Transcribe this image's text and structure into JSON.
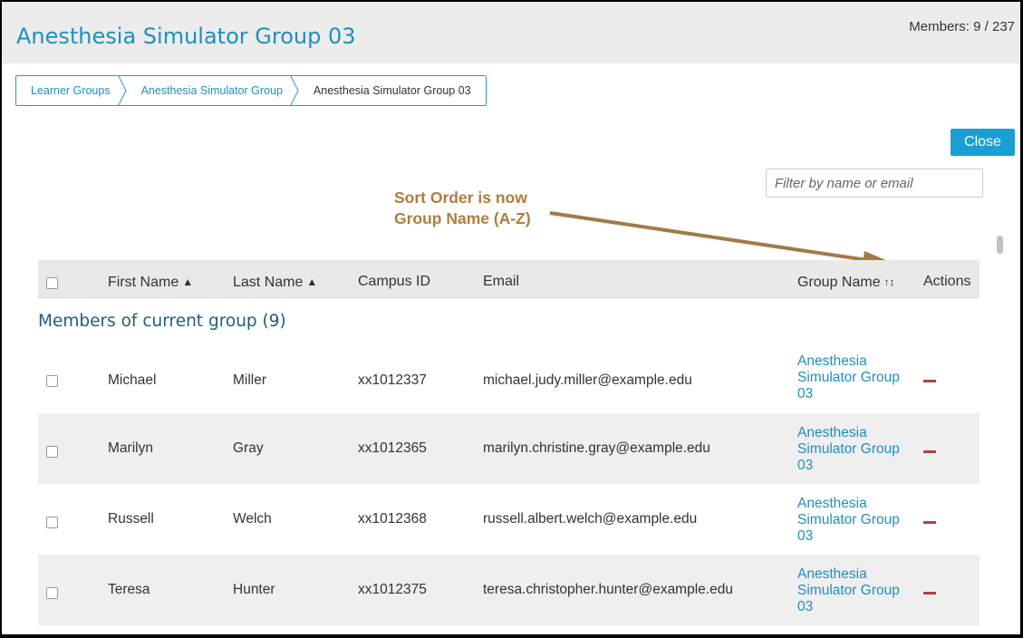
{
  "header": {
    "title": "Anesthesia Simulator Group 03",
    "members_count": "Members: 9 / 237"
  },
  "breadcrumb": [
    {
      "label": "Learner Groups"
    },
    {
      "label": "Anesthesia Simulator Group"
    },
    {
      "label": "Anesthesia Simulator Group 03"
    }
  ],
  "close_label": "Close",
  "filter": {
    "placeholder": "Filter by name or email",
    "value": ""
  },
  "annotation": {
    "line1": "Sort Order is now",
    "line2": "Group Name (A-Z)",
    "color": "#b07d3c"
  },
  "table": {
    "columns": {
      "first_name": "First Name",
      "last_name": "Last Name",
      "campus_id": "Campus ID",
      "email": "Email",
      "group_name": "Group Name",
      "actions": "Actions"
    },
    "sort_icon": "sort-up-down-icon",
    "active_sort_icon": "sort-alpha-asc-icon"
  },
  "group_heading": "Members of current group (9)",
  "rows": [
    {
      "first": "Michael",
      "last": "Miller",
      "campus_id": "xx1012337",
      "email": "michael.judy.miller@example.edu",
      "group": [
        "Anesthesia",
        "Simulator Group",
        "03"
      ]
    },
    {
      "first": "Marilyn",
      "last": "Gray",
      "campus_id": "xx1012365",
      "email": "marilyn.christine.gray@example.edu",
      "group": [
        "Anesthesia",
        "Simulator Group",
        "03"
      ]
    },
    {
      "first": "Russell",
      "last": "Welch",
      "campus_id": "xx1012368",
      "email": "russell.albert.welch@example.edu",
      "group": [
        "Anesthesia",
        "Simulator Group",
        "03"
      ]
    },
    {
      "first": "Teresa",
      "last": "Hunter",
      "campus_id": "xx1012375",
      "email": "teresa.christopher.hunter@example.edu",
      "group": [
        "Anesthesia",
        "Simulator Group",
        "03"
      ]
    }
  ],
  "colors": {
    "accent": "#1f8fc0",
    "button": "#1a9fd3",
    "remove": "#b2423f"
  }
}
